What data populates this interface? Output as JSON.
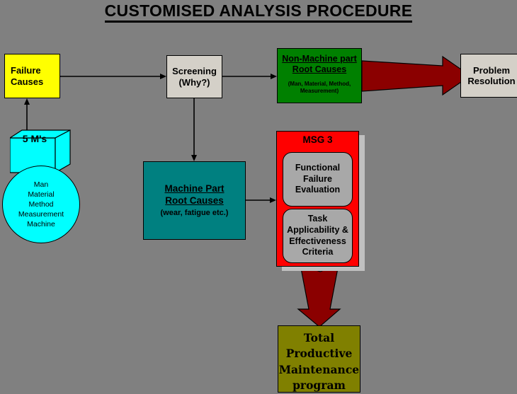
{
  "page": {
    "title": "CUSTOMISED ANALYSIS PROCEDURE",
    "background_color": "#808080"
  },
  "nodes": {
    "failure_causes": {
      "line1": "Failure",
      "line2": "Causes",
      "color": "#ffff00"
    },
    "five_ms": {
      "label": "5 M's",
      "color": "#00ffff",
      "items": [
        "Man",
        "Material",
        "Method",
        "Measurement",
        "Machine"
      ]
    },
    "screening": {
      "line1": "Screening",
      "line2": "(Why?)",
      "color": "#d4d0c8"
    },
    "non_machine": {
      "title_line1": "Non-Machine part",
      "title_line2": "Root Causes",
      "subtitle_line1": "(Man, Material, Method,",
      "subtitle_line2": "Measurement)",
      "color": "#008000"
    },
    "problem_resolution": {
      "line1": "Problem",
      "line2": "Resolution",
      "color": "#d4d0c8"
    },
    "machine_part": {
      "title_line1": "Machine Part",
      "title_line2": "Root Causes",
      "subtitle": "(wear, fatigue etc.)",
      "color": "#008080"
    },
    "msg3": {
      "label": "MSG 3",
      "color": "#ff0000",
      "items": [
        {
          "line1": "Functional",
          "line2": "Failure",
          "line3": "Evaluation"
        },
        {
          "line1": "Task",
          "line2": "Applicability &",
          "line3": "Effectiveness",
          "line4": "Criteria"
        }
      ]
    },
    "tpm": {
      "line1": "Total",
      "line2": "Productive",
      "line3": "Maintenance",
      "line4": "program",
      "color": "#808000"
    }
  },
  "arrows": {
    "accent_color": "#8b0000",
    "line_color": "#000000"
  }
}
